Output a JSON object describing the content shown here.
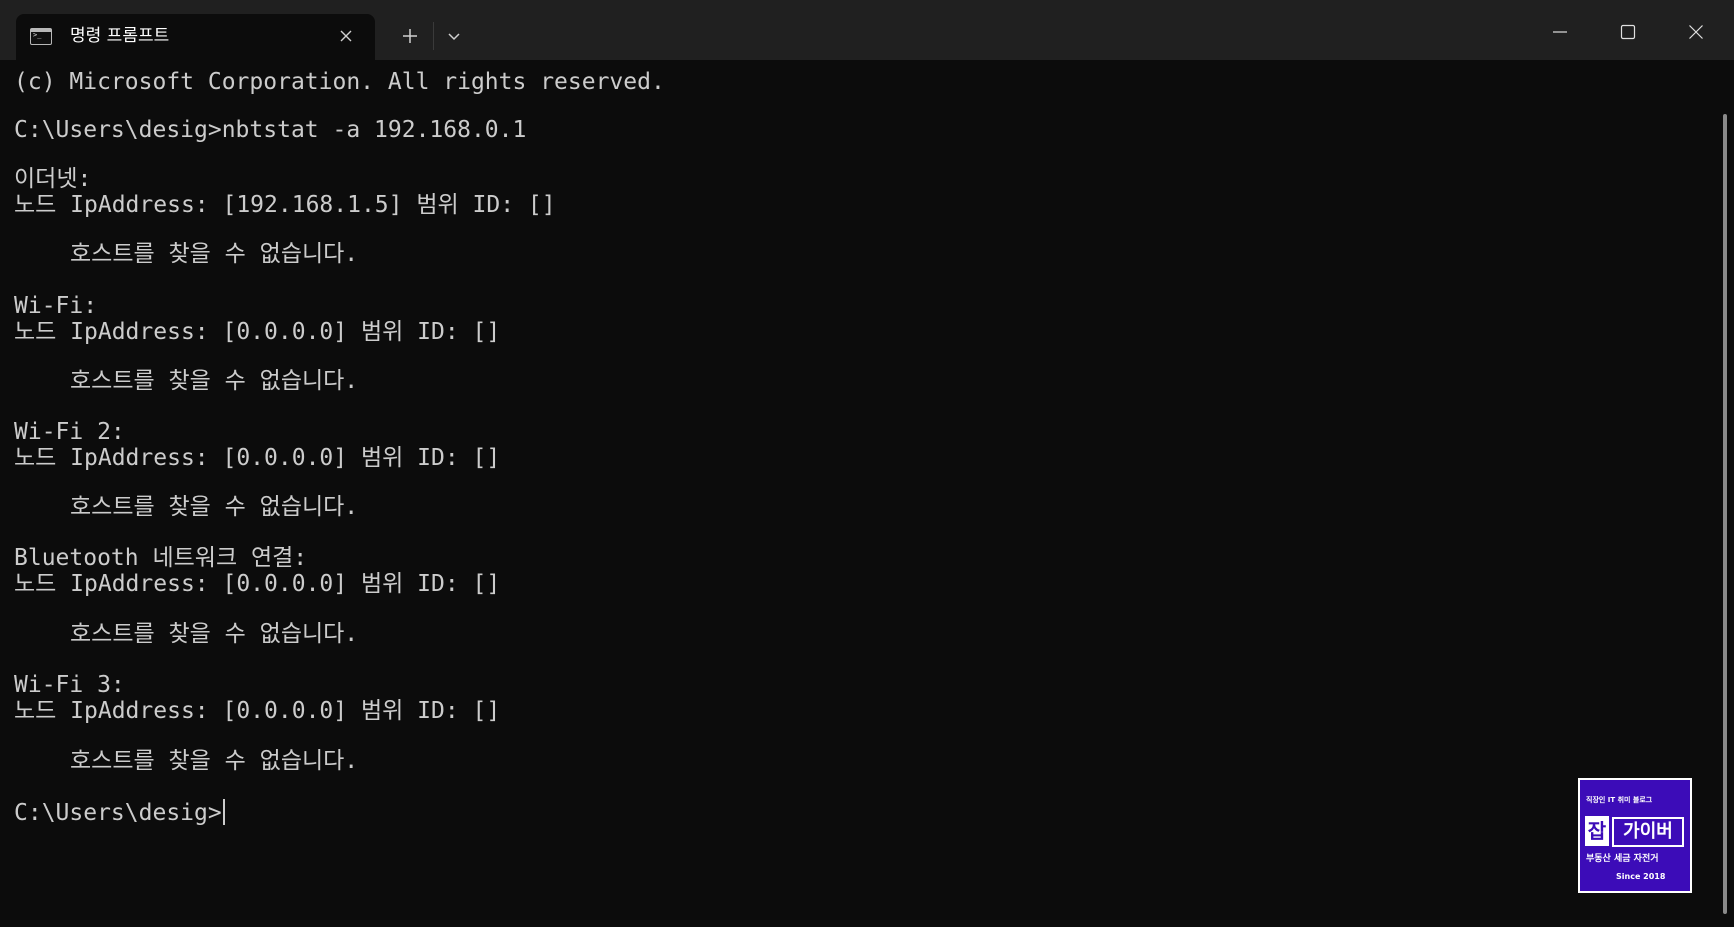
{
  "window": {
    "tab_title": "명령 프롬프트",
    "icons": {
      "tab": "terminal-icon",
      "tab_close": "close-icon",
      "new_tab": "plus-icon",
      "dropdown": "chevron-down-icon",
      "minimize": "minimize-icon",
      "maximize": "maximize-icon",
      "close": "close-icon"
    }
  },
  "terminal": {
    "lines": [
      "(c) Microsoft Corporation. All rights reserved.",
      "C:\\Users\\desig>nbtstat -a 192.168.0.1",
      "이더넷:",
      "노드 IpAddress: [192.168.1.5] 범위 ID: []",
      "호스트를 찾을 수 없습니다.",
      "Wi-Fi:",
      "노드 IpAddress: [0.0.0.0] 범위 ID: []",
      "호스트를 찾을 수 없습니다.",
      "Wi-Fi 2:",
      "노드 IpAddress: [0.0.0.0] 범위 ID: []",
      "호스트를 찾을 수 없습니다.",
      "Bluetooth 네트워크 연결:",
      "노드 IpAddress: [0.0.0.0] 범위 ID: []",
      "호스트를 찾을 수 없습니다.",
      "Wi-Fi 3:",
      "노드 IpAddress: [0.0.0.0] 범위 ID: []",
      "호스트를 찾을 수 없습니다.",
      "C:\\Users\\desig>"
    ]
  },
  "watermark": {
    "top": "직장인 IT 취미 블로그",
    "big": "잡",
    "box": "가이버",
    "sub": "부동산 세금 자전거",
    "since": "Since 2018"
  },
  "colors": {
    "terminal_bg": "#0c0c0c",
    "titlebar_bg": "#202020",
    "text": "#cccccc",
    "watermark_bg": "#3c0cb8"
  }
}
